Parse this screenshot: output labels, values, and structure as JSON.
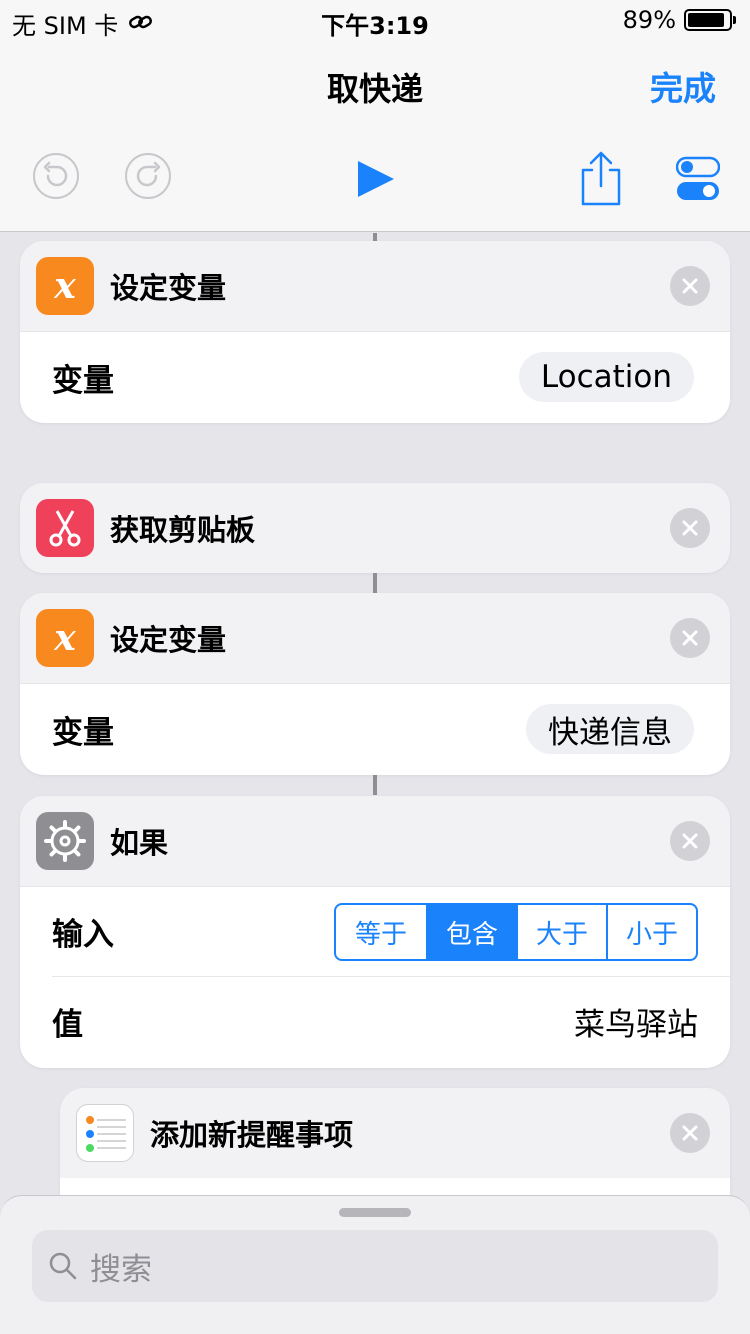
{
  "status_bar": {
    "carrier": "无 SIM 卡",
    "time": "下午3:19",
    "battery": "89%",
    "battery_level": 0.89
  },
  "nav": {
    "title": "取快递",
    "done": "完成"
  },
  "toolbar": {
    "undo_icon": "undo-icon",
    "redo_icon": "redo-icon",
    "play_icon": "play-icon",
    "share_icon": "share-icon",
    "settings_icon": "toggle-settings-icon"
  },
  "actions": [
    {
      "title": "设定变量",
      "icon": "variable-icon",
      "icon_color": "#f7891f",
      "row_label": "变量",
      "row_value": "Location"
    },
    {
      "title": "获取剪贴板",
      "icon": "scissors-icon",
      "icon_color": "#f0415b"
    },
    {
      "title": "设定变量",
      "icon": "variable-icon",
      "icon_color": "#f7891f",
      "row_label": "变量",
      "row_value": "快递信息"
    },
    {
      "title": "如果",
      "icon": "gear-icon",
      "icon_color": "#8e8e93",
      "input_label": "输入",
      "segments": [
        "等于",
        "包含",
        "大于",
        "小于"
      ],
      "selected_segment": "包含",
      "value_label": "值",
      "value": "菜鸟驿站"
    },
    {
      "title": "添加新提醒事项",
      "icon": "reminders-icon"
    }
  ],
  "search": {
    "placeholder": "搜索"
  },
  "colors": {
    "accent": "#1a82fb"
  }
}
